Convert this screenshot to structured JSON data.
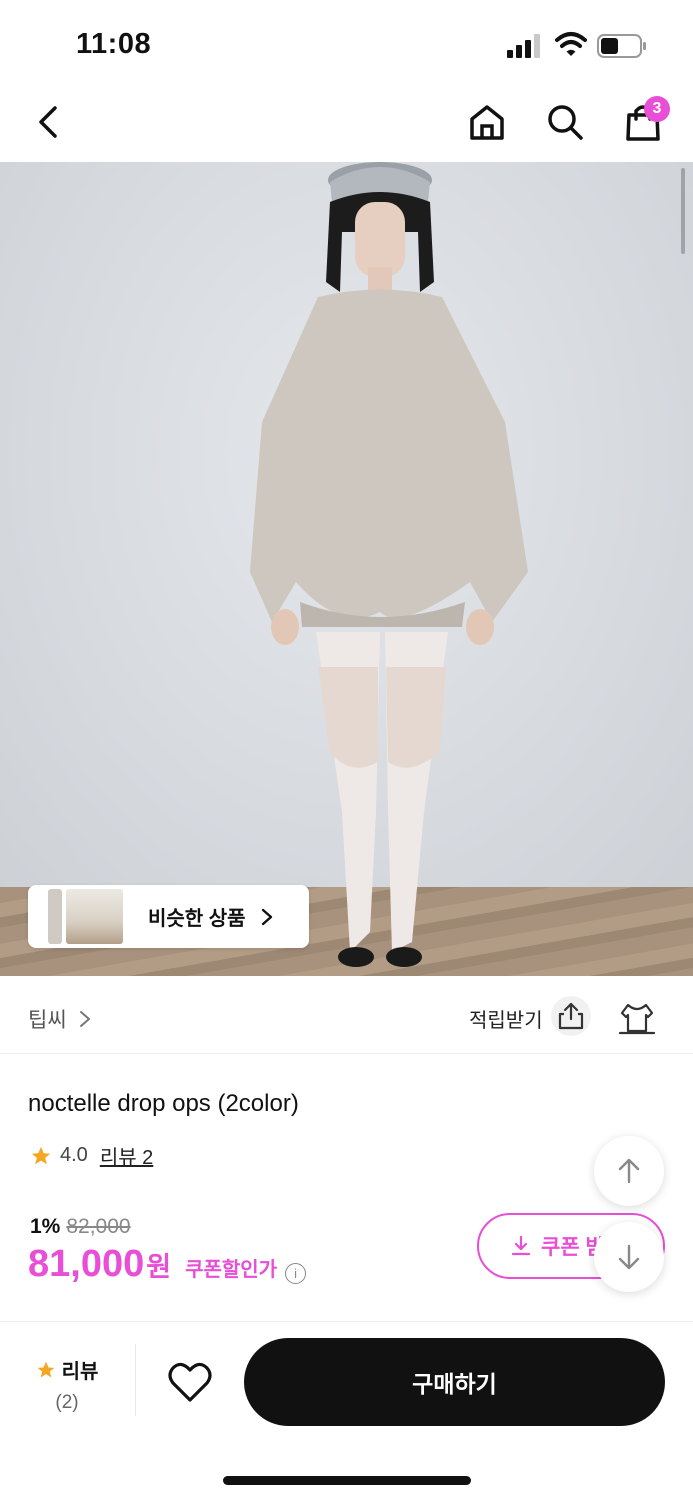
{
  "status_bar": {
    "time": "11:08"
  },
  "nav": {
    "cart_count": "3"
  },
  "hero": {
    "similar_label": "비슷한 상품"
  },
  "brand": {
    "name": "팁씨",
    "points_label": "적립받기"
  },
  "product": {
    "title": "noctelle drop ops (2color)",
    "rating": "4.0",
    "review_link": "리뷰 2",
    "discount_pct": "1%",
    "original_price": "82,000",
    "price": "81,000",
    "currency": "원",
    "coupon_price_label": "쿠폰할인가",
    "coupon_button": "쿠폰 받"
  },
  "bottom_bar": {
    "review_label": "리뷰",
    "review_count": "(2)",
    "buy_label": "구매하기"
  },
  "colors": {
    "accent": "#e84ed6",
    "star": "#f5a623",
    "buy_bg": "#111111"
  }
}
